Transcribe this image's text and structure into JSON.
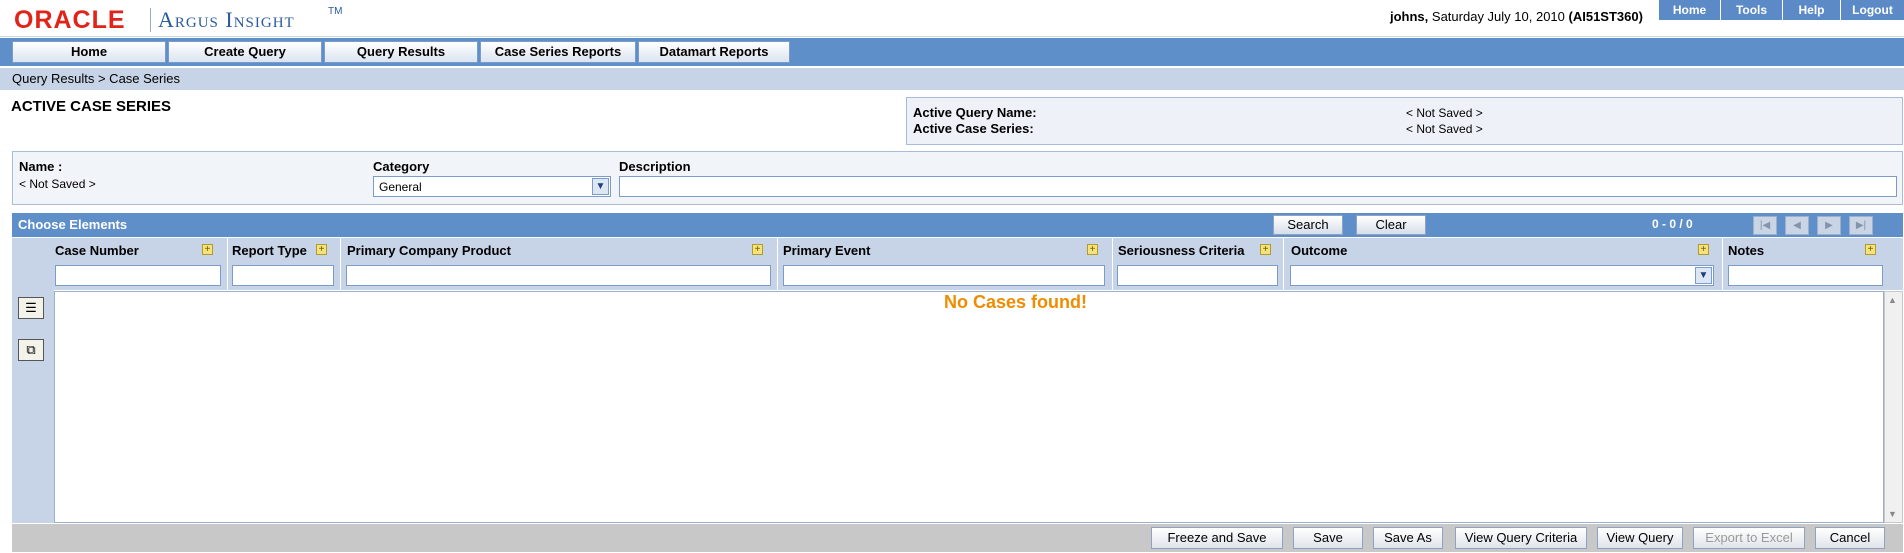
{
  "header": {
    "brand": "ORACLE",
    "product": "Argus Insight",
    "tm": "TM",
    "user": "johns,",
    "date": "Saturday July 10, 2010",
    "server": "(AI51ST360)",
    "toplinks": [
      "Home",
      "Tools",
      "Help",
      "Logout"
    ]
  },
  "nav": {
    "tabs": [
      "Home",
      "Create Query",
      "Query Results",
      "Case Series Reports",
      "Datamart Reports"
    ]
  },
  "breadcrumb": "Query Results  >  Case Series",
  "page": {
    "title": "ACTIVE CASE SERIES",
    "active_query_label": "Active Query Name:",
    "active_query_value": "< Not Saved >",
    "active_series_label": "Active Case Series:",
    "active_series_value": "< Not Saved >"
  },
  "props": {
    "name_label": "Name :",
    "name_value": "< Not Saved >",
    "category_label": "Category",
    "category_value": "General",
    "description_label": "Description",
    "description_value": ""
  },
  "choose": {
    "title": "Choose Elements",
    "search": "Search",
    "clear": "Clear",
    "count": "0 - 0 / 0"
  },
  "columns": [
    {
      "name": "Case Number"
    },
    {
      "name": "Report Type"
    },
    {
      "name": "Primary Company Product"
    },
    {
      "name": "Primary Event"
    },
    {
      "name": "Seriousness Criteria"
    },
    {
      "name": "Outcome"
    },
    {
      "name": "Notes"
    }
  ],
  "results": {
    "empty_message": "No Cases found!"
  },
  "footer": {
    "buttons": [
      "Freeze and Save",
      "Save",
      "Save As",
      "View Query Criteria",
      "View Query",
      "Export to Excel",
      "Cancel"
    ]
  },
  "colors": {
    "nav_blue": "#5f8fc8",
    "light_blue": "#c7d3e6",
    "empty_orange": "#f08c00"
  }
}
